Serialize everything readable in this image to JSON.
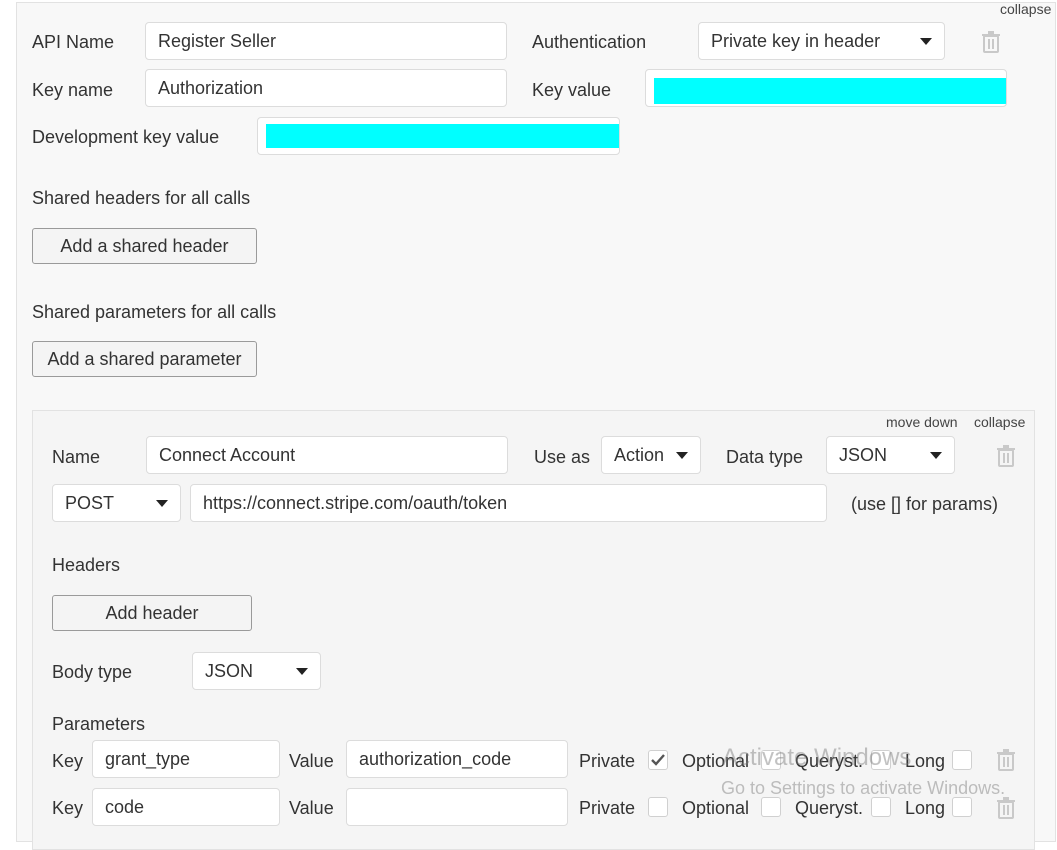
{
  "api": {
    "collapse_label": "collapse",
    "name_label": "API Name",
    "name_value": "Register Seller",
    "auth_label": "Authentication",
    "auth_value": "Private key in header",
    "key_name_label": "Key name",
    "key_name_value": "Authorization",
    "key_value_label": "Key value",
    "dev_key_label": "Development key value",
    "shared_headers_label": "Shared headers for all calls",
    "add_shared_header": "Add a shared header",
    "shared_params_label": "Shared parameters for all calls",
    "add_shared_param": "Add a shared parameter"
  },
  "call": {
    "move_down": "move down",
    "collapse": "collapse",
    "name_label": "Name",
    "name_value": "Connect Account",
    "use_as_label": "Use as",
    "use_as_value": "Action",
    "data_type_label": "Data type",
    "data_type_value": "JSON",
    "method": "POST",
    "url": "https://connect.stripe.com/oauth/token",
    "params_hint": "(use [] for params)",
    "headers_label": "Headers",
    "add_header": "Add header",
    "body_type_label": "Body type",
    "body_type_value": "JSON",
    "parameters_label": "Parameters",
    "params": [
      {
        "key_label": "Key",
        "key": "grant_type",
        "value_label": "Value",
        "value": "authorization_code",
        "private_label": "Private",
        "private": true,
        "optional_label": "Optional",
        "optional": false,
        "queryst_label": "Queryst.",
        "queryst": false,
        "long_label": "Long",
        "long": false
      },
      {
        "key_label": "Key",
        "key": "code",
        "value_label": "Value",
        "value": "",
        "private_label": "Private",
        "private": false,
        "optional_label": "Optional",
        "optional": false,
        "queryst_label": "Queryst.",
        "queryst": false,
        "long_label": "Long",
        "long": false
      }
    ]
  },
  "watermark": {
    "line1": "Activate Windows",
    "line2": "Go to Settings to activate Windows."
  },
  "colors": {
    "redaction": "#00ffff",
    "panel_bg": "#f8f8f8",
    "check": "#555555"
  },
  "icons": [
    "trash-icon",
    "chevron-down-icon",
    "checkmark-icon"
  ]
}
